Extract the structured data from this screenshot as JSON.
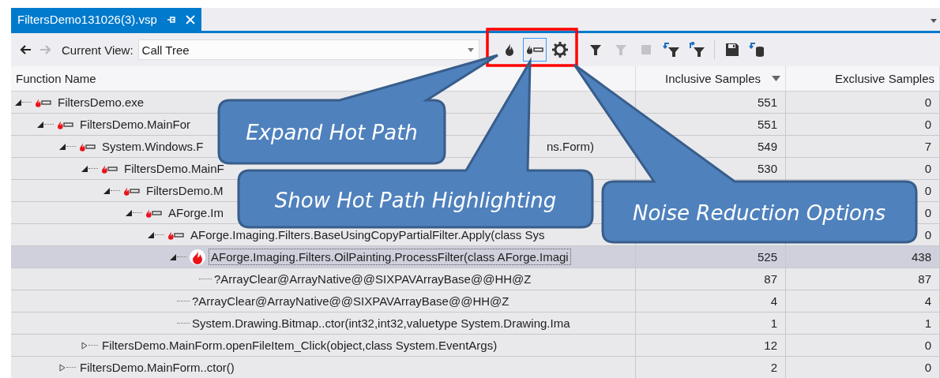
{
  "tab": {
    "title": "FiltersDemo131026(3).vsp",
    "selected": true
  },
  "nav": [
    {
      "kind": "back",
      "disabled": false
    },
    {
      "kind": "forward",
      "disabled": true
    }
  ],
  "view_label": "Current View:",
  "view_combo": {
    "value": "Call Tree"
  },
  "tools": [
    {
      "kind": "flame",
      "disabled": false,
      "checked": false
    },
    {
      "kind": "hot-path",
      "disabled": false,
      "checked": true
    },
    {
      "kind": "gear",
      "disabled": false,
      "checked": false
    },
    {
      "kind": "filter",
      "disabled": false,
      "checked": false
    },
    {
      "kind": "filter",
      "disabled": true,
      "checked": false
    },
    {
      "kind": "stop",
      "disabled": true,
      "checked": false
    },
    {
      "kind": "filter-back",
      "disabled": false,
      "checked": false
    },
    {
      "kind": "filter-forward",
      "disabled": false,
      "checked": false
    },
    {
      "kind": "save",
      "disabled": false,
      "checked": false
    },
    {
      "kind": "export",
      "disabled": false,
      "checked": false
    }
  ],
  "columns": [
    {
      "label": "Function Name",
      "sorted": false
    },
    {
      "label": "Inclusive Samples",
      "sorted": true
    },
    {
      "label": "Exclusive Samples",
      "sorted": false
    }
  ],
  "rows": [
    {
      "name": "FiltersDemo.exe",
      "kind": "hot-path",
      "expanded": true,
      "selected": false,
      "inclusive": "551",
      "exclusive": "0",
      "children": [
        {
          "name": "FiltersDemo.MainFor",
          "kind": "hot-path",
          "expanded": true,
          "selected": false,
          "inclusive": "551",
          "exclusive": "0",
          "children": [
            {
              "name": "System.Windows.F",
              "tail": "ns.Form)",
              "kind": "hot-path",
              "expanded": true,
              "selected": false,
              "inclusive": "549",
              "exclusive": "7",
              "children": [
                {
                  "name": "FiltersDemo.MainF",
                  "kind": "hot-path",
                  "expanded": true,
                  "selected": false,
                  "inclusive": "530",
                  "exclusive": "0",
                  "children": [
                    {
                      "name": "FiltersDemo.M",
                      "kind": "hot-path",
                      "expanded": true,
                      "selected": false,
                      "exclusive": "0",
                      "children": [
                        {
                          "name": "AForge.Im",
                          "kind": "hot-path",
                          "expanded": true,
                          "selected": false,
                          "exclusive": "0",
                          "children": [
                            {
                              "name": "AForge.Imaging.Filters.BaseUsingCopyPartialFilter.Apply(class Sys",
                              "kind": "hot-path",
                              "expanded": true,
                              "selected": false,
                              "exclusive": "0",
                              "children": [
                                {
                                  "name": "AForge.Imaging.Filters.OilPainting.ProcessFilter(class AForge.Imagi",
                                  "kind": "hotspot",
                                  "expanded": true,
                                  "selected": true,
                                  "inclusive": "525",
                                  "exclusive": "438",
                                  "children": [
                                    {
                                      "name": "?ArrayClear@ArrayNative@@SIXPAVArrayBase@@HH@Z",
                                      "kind": "plain",
                                      "selected": false,
                                      "inclusive": "87",
                                      "exclusive": "87"
                                    }
                                  ]
                                },
                                {
                                  "name": "?ArrayClear@ArrayNative@@SIXPAVArrayBase@@HH@Z",
                                  "kind": "plain",
                                  "selected": false,
                                  "inclusive": "4",
                                  "exclusive": "4"
                                },
                                {
                                  "name": "System.Drawing.Bitmap..ctor(int32,int32,valuetype System.Drawing.Ima",
                                  "kind": "plain",
                                  "selected": false,
                                  "inclusive": "1",
                                  "exclusive": "1"
                                }
                              ]
                            }
                          ]
                        }
                      ]
                    }
                  ]
                },
                {
                  "name": "FiltersDemo.MainForm.openFileItem_Click(object,class System.EventArgs)",
                  "kind": "plain",
                  "expanded": false,
                  "selected": false,
                  "inclusive": "12",
                  "exclusive": "0"
                }
              ]
            },
            {
              "name": "FiltersDemo.MainForm..ctor()",
              "kind": "plain",
              "expanded": false,
              "selected": false,
              "inclusive": "2",
              "exclusive": "0"
            }
          ]
        }
      ]
    }
  ],
  "callouts": [
    {
      "text": "Expand Hot Path"
    },
    {
      "text": "Show Hot Path Highlighting"
    },
    {
      "text": "Noise Reduction Options"
    }
  ]
}
